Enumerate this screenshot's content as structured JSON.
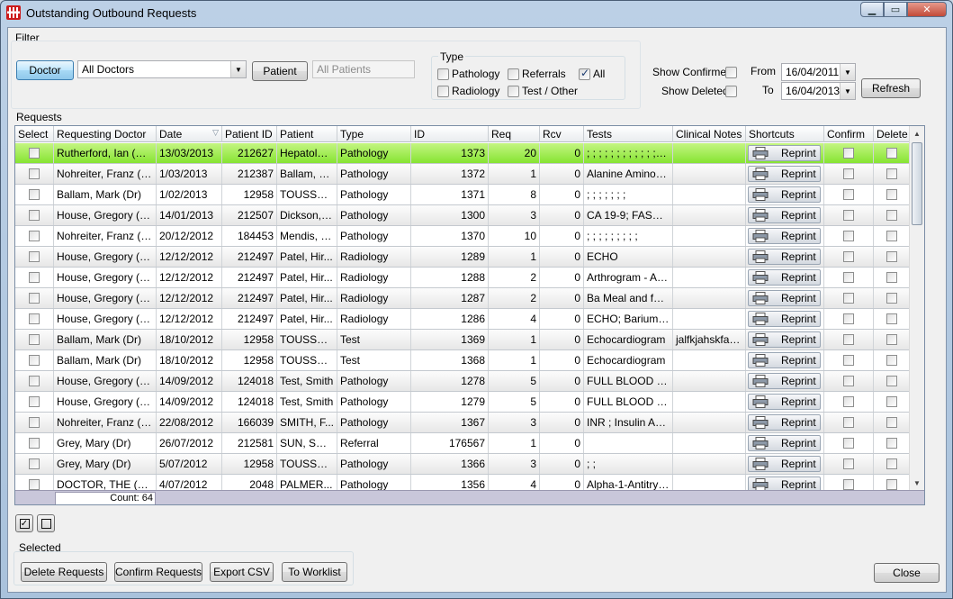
{
  "window": {
    "title": "Outstanding Outbound Requests"
  },
  "filter": {
    "label": "Filter",
    "doctor_button": "Doctor",
    "doctor_value": "All Doctors",
    "patient_button": "Patient",
    "patient_placeholder": "All Patients",
    "type_label": "Type",
    "types": {
      "pathology": "Pathology",
      "referrals": "Referrals",
      "all": "All",
      "radiology": "Radiology",
      "test_other": "Test / Other"
    },
    "show_confirmed": "Show Confirmed",
    "show_deleted": "Show Deleted",
    "from_label": "From",
    "to_label": "To",
    "from_value": "16/04/2011",
    "to_value": "16/04/2013",
    "refresh": "Refresh"
  },
  "requests": {
    "label": "Requests",
    "columns": [
      "Select",
      "Requesting Doctor",
      "Date",
      "Patient ID",
      "Patient",
      "Type",
      "ID",
      "Req",
      "Rcv",
      "Tests",
      "Clinical Notes",
      "Shortcuts",
      "Confirm",
      "Delete"
    ],
    "reprint_label": "Reprint",
    "rows": [
      {
        "doctor": "Rutherford, Ian (Prof)",
        "date": "13/03/2013",
        "pid": "212627",
        "patient": "Hepatolog...",
        "type": "Pathology",
        "id": "1373",
        "req": "20",
        "rcv": "0",
        "tests": "; ; ; ; ; ; ; ; ; ; ; ; ;...",
        "notes": ""
      },
      {
        "doctor": "Nohreiter, Franz (Dr)",
        "date": "1/03/2013",
        "pid": "212387",
        "patient": "Ballam, M...",
        "type": "Pathology",
        "id": "1372",
        "req": "1",
        "rcv": "0",
        "tests": "Alanine Aminotra...",
        "notes": ""
      },
      {
        "doctor": "Ballam, Mark (Dr)",
        "date": "1/02/2013",
        "pid": "12958",
        "patient": "TOUSSAI...",
        "type": "Pathology",
        "id": "1371",
        "req": "8",
        "rcv": "0",
        "tests": "; ; ; ; ; ; ;",
        "notes": ""
      },
      {
        "doctor": "House, Gregory (Dr)",
        "date": "14/01/2013",
        "pid": "212507",
        "patient": "Dickson, P...",
        "type": "Pathology",
        "id": "1300",
        "req": "3",
        "rcv": "0",
        "tests": "CA 19-9; FASTI...",
        "notes": ""
      },
      {
        "doctor": "Nohreiter, Franz (Dr)",
        "date": "20/12/2012",
        "pid": "184453",
        "patient": "Mendis, Ni...",
        "type": "Pathology",
        "id": "1370",
        "req": "10",
        "rcv": "0",
        "tests": "; ; ; ; ; ; ; ; ;",
        "notes": ""
      },
      {
        "doctor": "House, Gregory (Dr)",
        "date": "12/12/2012",
        "pid": "212497",
        "patient": "Patel, Hir...",
        "type": "Radiology",
        "id": "1289",
        "req": "1",
        "rcv": "0",
        "tests": "ECHO",
        "notes": ""
      },
      {
        "doctor": "House, Gregory (Dr)",
        "date": "12/12/2012",
        "pid": "212497",
        "patient": "Patel, Hir...",
        "type": "Radiology",
        "id": "1288",
        "req": "2",
        "rcv": "0",
        "tests": "Arthrogram - Ab...",
        "notes": ""
      },
      {
        "doctor": "House, Gregory (Dr)",
        "date": "12/12/2012",
        "pid": "212497",
        "patient": "Patel, Hir...",
        "type": "Radiology",
        "id": "1287",
        "req": "2",
        "rcv": "0",
        "tests": "Ba Meal and foll...",
        "notes": ""
      },
      {
        "doctor": "House, Gregory (Dr)",
        "date": "12/12/2012",
        "pid": "212497",
        "patient": "Patel, Hir...",
        "type": "Radiology",
        "id": "1286",
        "req": "4",
        "rcv": "0",
        "tests": "ECHO; Barium e...",
        "notes": ""
      },
      {
        "doctor": "Ballam, Mark (Dr)",
        "date": "18/10/2012",
        "pid": "12958",
        "patient": "TOUSSAI...",
        "type": "Test",
        "id": "1369",
        "req": "1",
        "rcv": "0",
        "tests": "Echocardiogram",
        "notes": "jalfkjahskfas..."
      },
      {
        "doctor": "Ballam, Mark (Dr)",
        "date": "18/10/2012",
        "pid": "12958",
        "patient": "TOUSSAI...",
        "type": "Test",
        "id": "1368",
        "req": "1",
        "rcv": "0",
        "tests": "Echocardiogram",
        "notes": ""
      },
      {
        "doctor": "House, Gregory (Dr)",
        "date": "14/09/2012",
        "pid": "124018",
        "patient": "Test, Smith",
        "type": "Pathology",
        "id": "1278",
        "req": "5",
        "rcv": "0",
        "tests": "FULL BLOOD EX...",
        "notes": ""
      },
      {
        "doctor": "House, Gregory (Dr)",
        "date": "14/09/2012",
        "pid": "124018",
        "patient": "Test, Smith",
        "type": "Pathology",
        "id": "1279",
        "req": "5",
        "rcv": "0",
        "tests": "FULL BLOOD EX...",
        "notes": ""
      },
      {
        "doctor": "Nohreiter, Franz (Dr)",
        "date": "22/08/2012",
        "pid": "166039",
        "patient": "SMITH, F...",
        "type": "Pathology",
        "id": "1367",
        "req": "3",
        "rcv": "0",
        "tests": "INR ; Insulin Anti...",
        "notes": ""
      },
      {
        "doctor": "Grey, Mary (Dr)",
        "date": "26/07/2012",
        "pid": "212581",
        "patient": "SUN, SHU...",
        "type": "Referral",
        "id": "176567",
        "req": "1",
        "rcv": "0",
        "tests": "",
        "notes": ""
      },
      {
        "doctor": "Grey, Mary (Dr)",
        "date": "5/07/2012",
        "pid": "12958",
        "patient": "TOUSSAI...",
        "type": "Pathology",
        "id": "1366",
        "req": "3",
        "rcv": "0",
        "tests": "; ;",
        "notes": ""
      },
      {
        "doctor": "DOCTOR, THE (DR)",
        "date": "4/07/2012",
        "pid": "2048",
        "patient": "PALMER...",
        "type": "Pathology",
        "id": "1356",
        "req": "4",
        "rcv": "0",
        "tests": "Alpha-1-Antitryp...",
        "notes": ""
      }
    ],
    "count_text": "Count: 64"
  },
  "selected": {
    "label": "Selected",
    "delete": "Delete Requests",
    "confirm": "Confirm Requests",
    "export": "Export CSV",
    "worklist": "To Worklist"
  },
  "close": "Close"
}
